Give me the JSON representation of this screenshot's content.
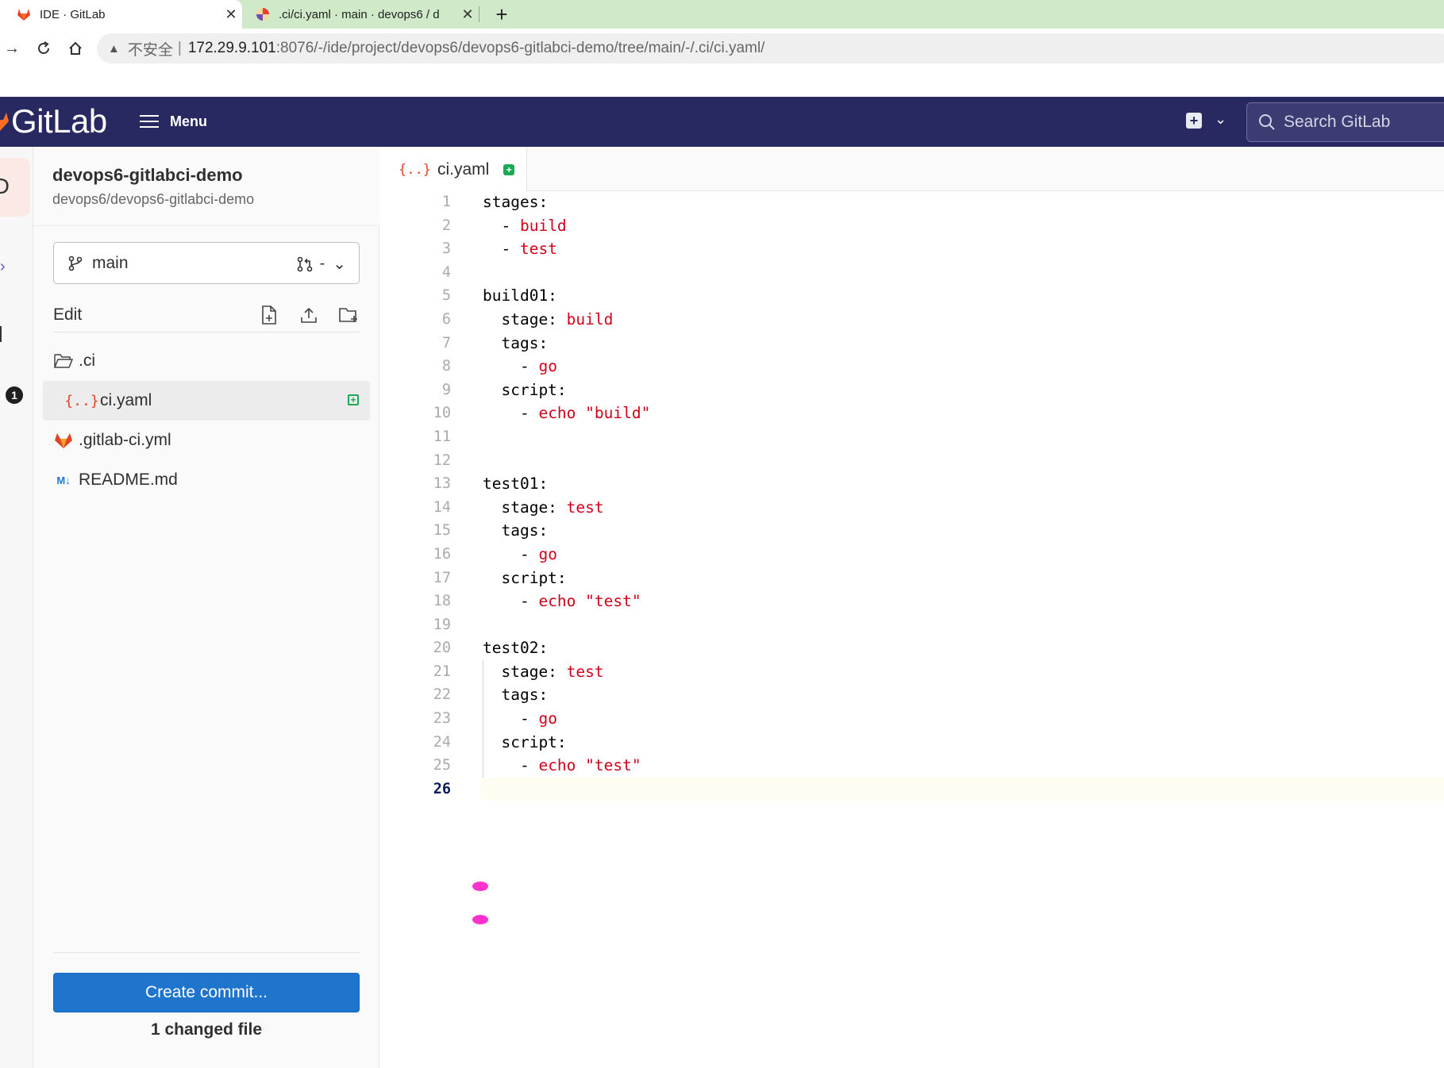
{
  "browser": {
    "tabs": [
      {
        "title": "IDE · GitLab",
        "active": true
      },
      {
        "title": ".ci/ci.yaml · main · devops6 / d",
        "active": false
      }
    ],
    "address": {
      "security_label": "不安全",
      "host": "172.29.9.101",
      "path": ":8076/-/ide/project/devops6/devops6-gitlabci-demo/tree/main/-/.ci/ci.yaml/"
    }
  },
  "gitlab": {
    "logo_text": "GitLab",
    "menu_label": "Menu",
    "search_placeholder": "Search GitLab",
    "colors": {
      "header": "#292961",
      "primary_button": "#1f75cb",
      "added": "#1aaa55",
      "yaml_value": "#d0021b"
    }
  },
  "rail": {
    "badge": "1"
  },
  "sidebar": {
    "project_name": "devops6-gitlabci-demo",
    "project_path": "devops6/devops6-gitlabci-demo",
    "branch": "main",
    "mr_label": "-",
    "edit_label": "Edit",
    "tree": [
      {
        "name": ".ci",
        "type": "folder"
      },
      {
        "name": "ci.yaml",
        "type": "yaml",
        "selected": true,
        "added": true
      },
      {
        "name": ".gitlab-ci.yml",
        "type": "gitlab"
      },
      {
        "name": "README.md",
        "type": "markdown"
      }
    ],
    "commit_button": "Create commit...",
    "changed_files": "1 changed file"
  },
  "editor": {
    "tab": {
      "name": "ci.yaml",
      "icon": "{..}"
    },
    "current_line": 26,
    "lines": [
      {
        "n": "1",
        "k": "stages:",
        "v": ""
      },
      {
        "n": "2",
        "k": "  - ",
        "v": "build"
      },
      {
        "n": "3",
        "k": "  - ",
        "v": "test"
      },
      {
        "n": "4",
        "k": "",
        "v": ""
      },
      {
        "n": "5",
        "k": "build01:",
        "v": ""
      },
      {
        "n": "6",
        "k": "  stage: ",
        "v": "build"
      },
      {
        "n": "7",
        "k": "  tags:",
        "v": ""
      },
      {
        "n": "8",
        "k": "    - ",
        "v": "go"
      },
      {
        "n": "9",
        "k": "  script:",
        "v": ""
      },
      {
        "n": "10",
        "k": "    - ",
        "v": "echo \"build\""
      },
      {
        "n": "11",
        "k": "",
        "v": ""
      },
      {
        "n": "12",
        "k": "",
        "v": ""
      },
      {
        "n": "13",
        "k": "test01:",
        "v": ""
      },
      {
        "n": "14",
        "k": "  stage: ",
        "v": "test"
      },
      {
        "n": "15",
        "k": "  tags:",
        "v": ""
      },
      {
        "n": "16",
        "k": "    - ",
        "v": "go"
      },
      {
        "n": "17",
        "k": "  script:",
        "v": ""
      },
      {
        "n": "18",
        "k": "    - ",
        "v": "echo \"test\""
      },
      {
        "n": "19",
        "k": "",
        "v": ""
      },
      {
        "n": "20",
        "k": "test02:",
        "v": ""
      },
      {
        "n": "21",
        "k": "  stage: ",
        "v": "test"
      },
      {
        "n": "22",
        "k": "  tags:",
        "v": ""
      },
      {
        "n": "23",
        "k": "    - ",
        "v": "go"
      },
      {
        "n": "24",
        "k": "  script:",
        "v": ""
      },
      {
        "n": "25",
        "k": "    - ",
        "v": "echo \"test\""
      },
      {
        "n": "26",
        "k": "",
        "v": ""
      }
    ]
  }
}
